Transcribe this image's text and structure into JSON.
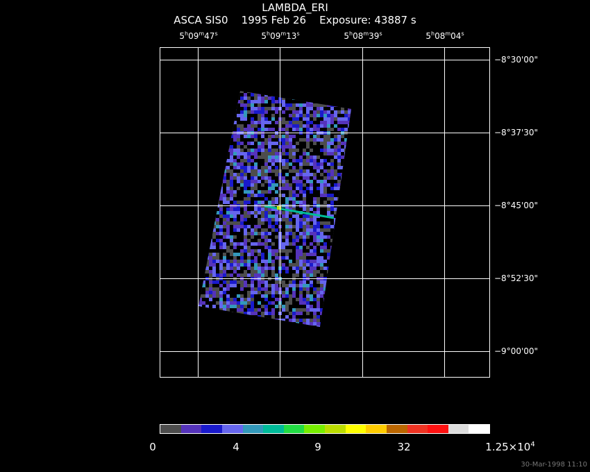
{
  "header": {
    "object": "LAMBDA_ERI",
    "instrument": "ASCA SIS0",
    "date": "1995 Feb 26",
    "exposure": "Exposure: 43887 s"
  },
  "ra_ticks": [
    {
      "h": "5",
      "m": "09",
      "s": "47"
    },
    {
      "h": "5",
      "m": "09",
      "s": "13"
    },
    {
      "h": "5",
      "m": "08",
      "s": "39"
    },
    {
      "h": "5",
      "m": "08",
      "s": "04"
    }
  ],
  "dec_ticks": [
    "−8°30'00\"",
    "−8°37'30\"",
    "−8°45'00\"",
    "−8°52'30\"",
    "−9°00'00\""
  ],
  "colorbar": {
    "colors": [
      "#4d4d4d",
      "#5533bb",
      "#1a1acc",
      "#6666ee",
      "#3399bb",
      "#00bb99",
      "#22dd44",
      "#77ee00",
      "#bbdd00",
      "#ffff00",
      "#ffcc00",
      "#bb6600",
      "#ee3322",
      "#ff1111",
      "#dddddd",
      "#ffffff"
    ],
    "labels": [
      "0",
      "4",
      "9",
      "32"
    ],
    "max_mantissa": "1.25×10",
    "max_exp": "4"
  },
  "timestamp": "30-Mar-1998 11:10"
}
